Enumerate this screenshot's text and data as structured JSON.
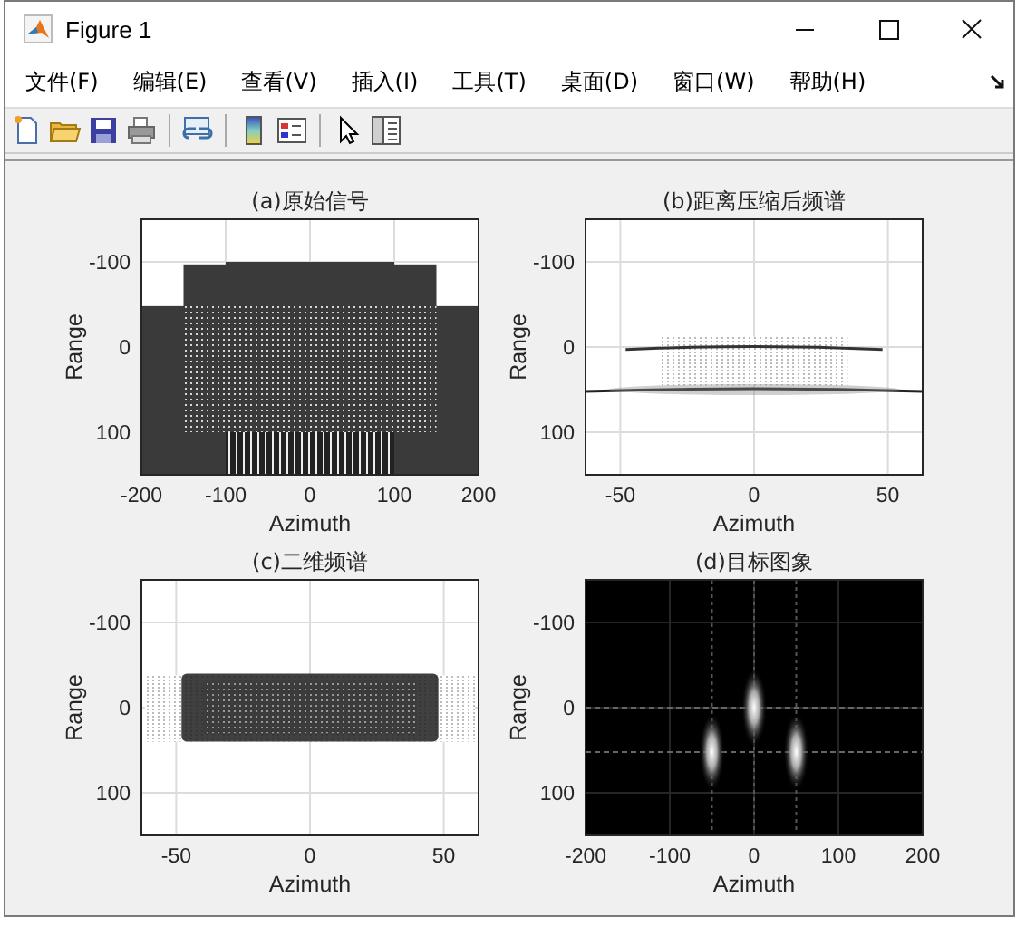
{
  "window": {
    "title": "Figure 1"
  },
  "menu": [
    {
      "label": "文件(F)"
    },
    {
      "label": "编辑(E)"
    },
    {
      "label": "查看(V)"
    },
    {
      "label": "插入(I)"
    },
    {
      "label": "工具(T)"
    },
    {
      "label": "桌面(D)"
    },
    {
      "label": "窗口(W)"
    },
    {
      "label": "帮助(H)"
    }
  ],
  "plots": [
    {
      "kind": "raw",
      "title": "(a)原始信号",
      "xlabel": "Azimuth",
      "ylabel": "Range",
      "xticks": [
        "-200",
        "-100",
        "0",
        "100",
        "200"
      ],
      "yticks": [
        "-100",
        "0",
        "100"
      ]
    },
    {
      "kind": "compressed",
      "title": "(b)距离压缩后频谱",
      "xlabel": "Azimuth",
      "ylabel": "Range",
      "xticks": [
        "-50",
        "0",
        "50"
      ],
      "yticks": [
        "-100",
        "0",
        "100"
      ]
    },
    {
      "kind": "spectrum",
      "title": "(c)二维频谱",
      "xlabel": "Azimuth",
      "ylabel": "Range",
      "xticks": [
        "-50",
        "0",
        "50"
      ],
      "yticks": [
        "-100",
        "0",
        "100"
      ]
    },
    {
      "kind": "target",
      "title": "(d)目标图象",
      "xlabel": "Azimuth",
      "ylabel": "Range",
      "xticks": [
        "-200",
        "-100",
        "0",
        "100",
        "200"
      ],
      "yticks": [
        "-100",
        "0",
        "100"
      ]
    }
  ]
}
